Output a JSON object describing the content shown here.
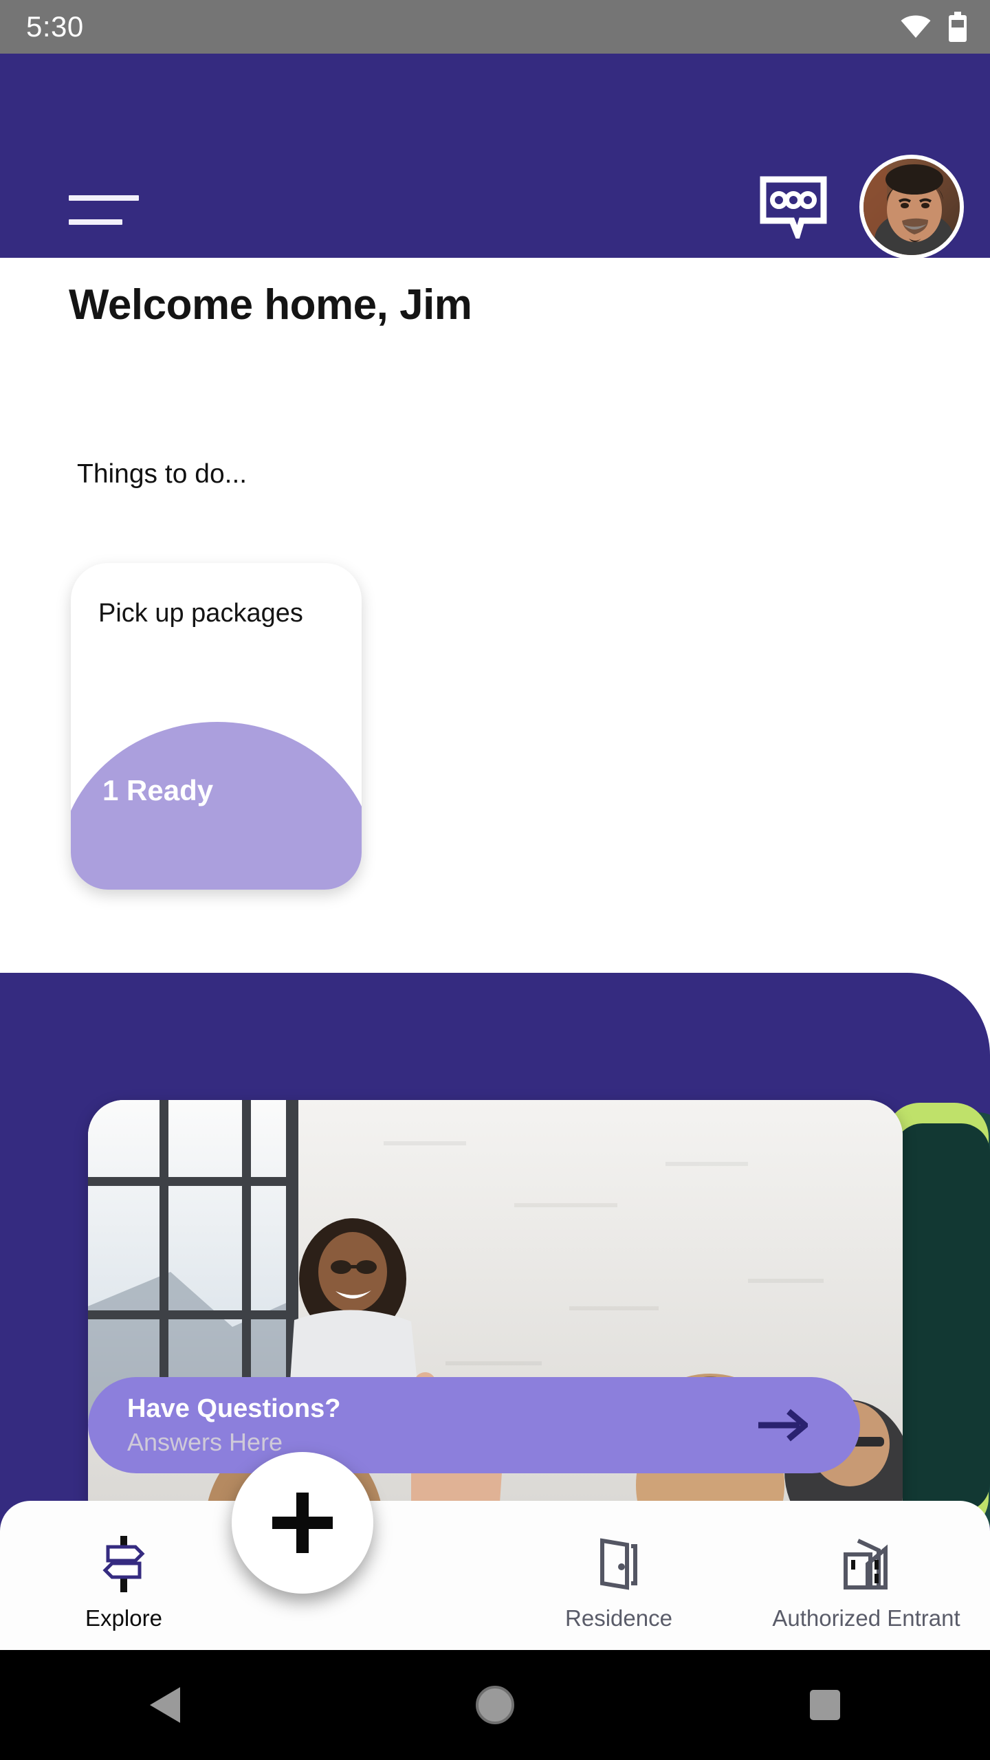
{
  "status_bar": {
    "time": "5:30",
    "icons": [
      "wifi-icon",
      "battery-icon"
    ]
  },
  "header": {
    "menu_icon": "hamburger-menu-icon",
    "chat_icon": "chat-bubble-icon",
    "avatar_icon": "user-avatar",
    "background_color": "#352b80"
  },
  "main": {
    "welcome_title": "Welcome home, Jim",
    "section_label": "Things to do...",
    "task_card": {
      "title": "Pick up packages",
      "count_label": "1 Ready",
      "blob_color": "#ab9fdd"
    }
  },
  "promo": {
    "banner": {
      "title": "Have Questions?",
      "subtitle": "Answers Here",
      "arrow_icon": "arrow-right-icon",
      "background_color": "#8c7fdc"
    },
    "accent_color": "#bfe16a"
  },
  "bottom_nav": {
    "items": [
      {
        "label": "Explore",
        "icon": "signpost-icon",
        "active": true
      },
      {
        "label": "Residence",
        "icon": "door-open-icon",
        "active": false
      },
      {
        "label": "Authorized Entrant",
        "icon": "buildings-icon",
        "active": false
      }
    ],
    "fab_icon": "plus-icon"
  },
  "system_nav": {
    "back": "back-triangle-icon",
    "home": "home-circle-icon",
    "recents": "recents-square-icon"
  }
}
